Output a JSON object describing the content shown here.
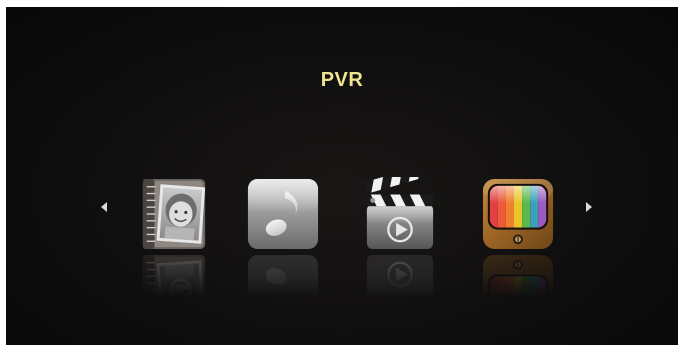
{
  "screen": {
    "title": "PVR",
    "title_color": "#efe58e",
    "background_color": "#0f0e0e"
  },
  "navigation": {
    "prev_icon": "triangle-left-icon",
    "next_icon": "triangle-right-icon"
  },
  "apps": [
    {
      "icon": "photo-album-icon",
      "selected": false
    },
    {
      "icon": "music-note-icon",
      "selected": false
    },
    {
      "icon": "clapperboard-icon",
      "selected": false
    },
    {
      "icon": "tv-icon",
      "selected": false
    }
  ]
}
